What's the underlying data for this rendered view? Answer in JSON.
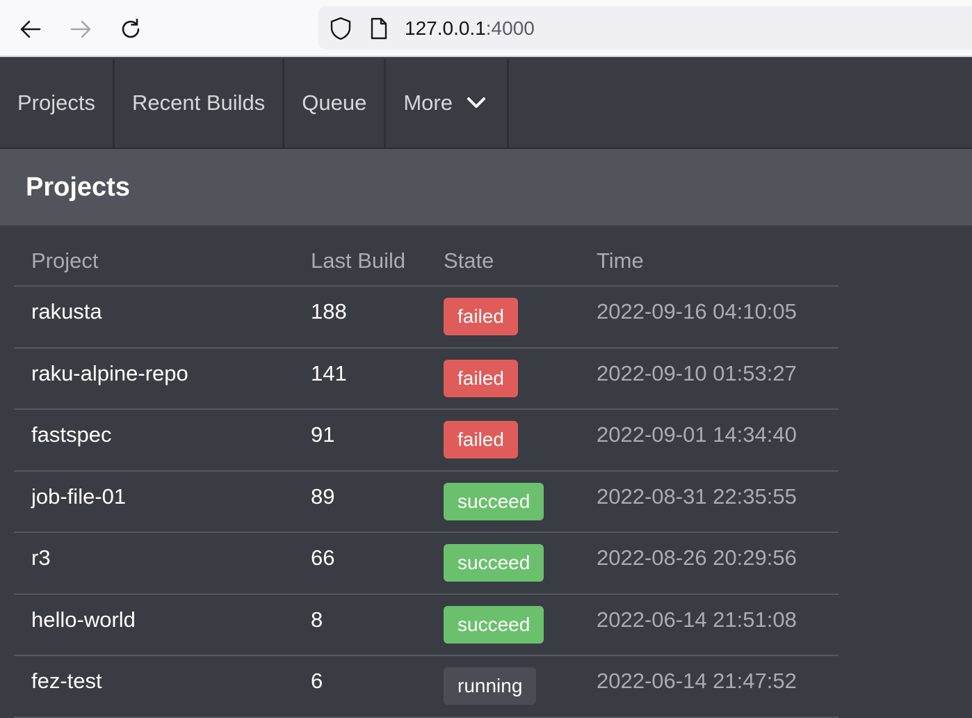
{
  "browser": {
    "url_host": "127.0.0.1",
    "url_port": ":4000",
    "icons": [
      "back-arrow-icon",
      "forward-arrow-icon",
      "reload-icon",
      "shield-icon",
      "page-icon"
    ]
  },
  "nav": {
    "projects": "Projects",
    "recent_builds": "Recent Builds",
    "queue": "Queue",
    "more": "More"
  },
  "page": {
    "title": "Projects"
  },
  "table": {
    "headers": {
      "project": "Project",
      "last_build": "Last Build",
      "state": "State",
      "time": "Time"
    },
    "rows": [
      {
        "project": "rakusta",
        "last_build": "188",
        "state": "failed",
        "time": "2022-09-16 04:10:05"
      },
      {
        "project": "raku-alpine-repo",
        "last_build": "141",
        "state": "failed",
        "time": "2022-09-10 01:53:27"
      },
      {
        "project": "fastspec",
        "last_build": "91",
        "state": "failed",
        "time": "2022-09-01 14:34:40"
      },
      {
        "project": "job-file-01",
        "last_build": "89",
        "state": "succeed",
        "time": "2022-08-31 22:35:55"
      },
      {
        "project": "r3",
        "last_build": "66",
        "state": "succeed",
        "time": "2022-08-26 20:29:56"
      },
      {
        "project": "hello-world",
        "last_build": "8",
        "state": "succeed",
        "time": "2022-06-14 21:51:08"
      },
      {
        "project": "fez-test",
        "last_build": "6",
        "state": "running",
        "time": "2022-06-14 21:47:52"
      }
    ]
  },
  "colors": {
    "failed": "#e05c5a",
    "succeed": "#6ac06c",
    "running": "#4a4d54",
    "background": "#393c42",
    "header_band": "#51555b"
  }
}
